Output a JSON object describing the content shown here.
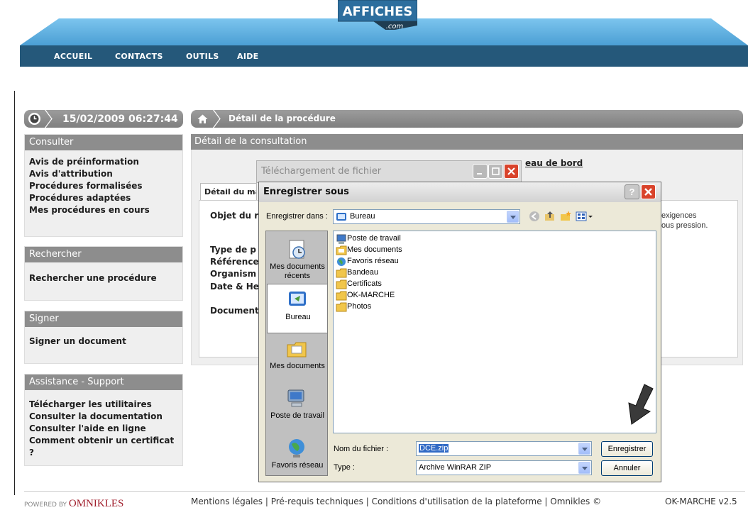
{
  "logo": {
    "text": "AFFICHES",
    "suffix": ".com"
  },
  "nav": {
    "items": [
      "ACCUEIL",
      "CONTACTS",
      "OUTILS",
      "AIDE"
    ]
  },
  "datetime": "15/02/2009 06:27:44",
  "breadcrumb": "Détail de la procédure",
  "panels": {
    "consulter": {
      "title": "Consulter",
      "links": [
        "Avis de préinformation",
        "Avis d'attribution",
        "Procédures formalisées",
        "Procédures adaptées",
        "Mes procédures en cours"
      ]
    },
    "rechercher": {
      "title": "Rechercher",
      "links": [
        "Rechercher une procédure"
      ]
    },
    "signer": {
      "title": "Signer",
      "links": [
        "Signer un document"
      ]
    },
    "assistance": {
      "title": "Assistance - Support",
      "links": [
        "Télécharger les utilitaires",
        "Consulter la documentation",
        "Consulter l'aide en ligne",
        "Comment obtenir un certificat ?"
      ]
    }
  },
  "main": {
    "title": "Détail de la consultation",
    "tableau_link": "eau de bord",
    "tab": "Détail du ma",
    "labels": [
      "Objet du r",
      "Type de p",
      "Référence",
      "Organism",
      "Date & He",
      "Document"
    ],
    "right_text": [
      "exigences",
      "ous pression."
    ]
  },
  "download_dialog": {
    "title": "Téléchargement de fichier"
  },
  "save_dialog": {
    "title": "Enregistrer sous",
    "save_in_label": "Enregistrer dans :",
    "save_in_value": "Bureau",
    "places": [
      "Mes documents récents",
      "Bureau",
      "Mes documents",
      "Poste de travail",
      "Favoris réseau"
    ],
    "files": [
      "Poste de travail",
      "Mes documents",
      "Favoris réseau",
      "Bandeau",
      "Certificats",
      "OK-MARCHE",
      "Photos"
    ],
    "filename_label": "Nom du fichier :",
    "filename_value": "DCE.zip",
    "type_label": "Type :",
    "type_value": "Archive WinRAR ZIP",
    "save_button": "Enregistrer",
    "cancel_button": "Annuler",
    "help_button": "?",
    "close_button": "X"
  },
  "footer": {
    "powered_prefix": "POWERED BY",
    "brand": "OMNIKLES",
    "links": "Mentions légales | Pré-requis techniques | Conditions d'utilisation de la plateforme | Omnikles ©",
    "version": "OK-MARCHE v2.5"
  },
  "colors": {
    "nav": "#25587a",
    "banner": "#5ba9d9",
    "panel_title": "#8d8d8d",
    "xp_close": "#d9432b"
  }
}
